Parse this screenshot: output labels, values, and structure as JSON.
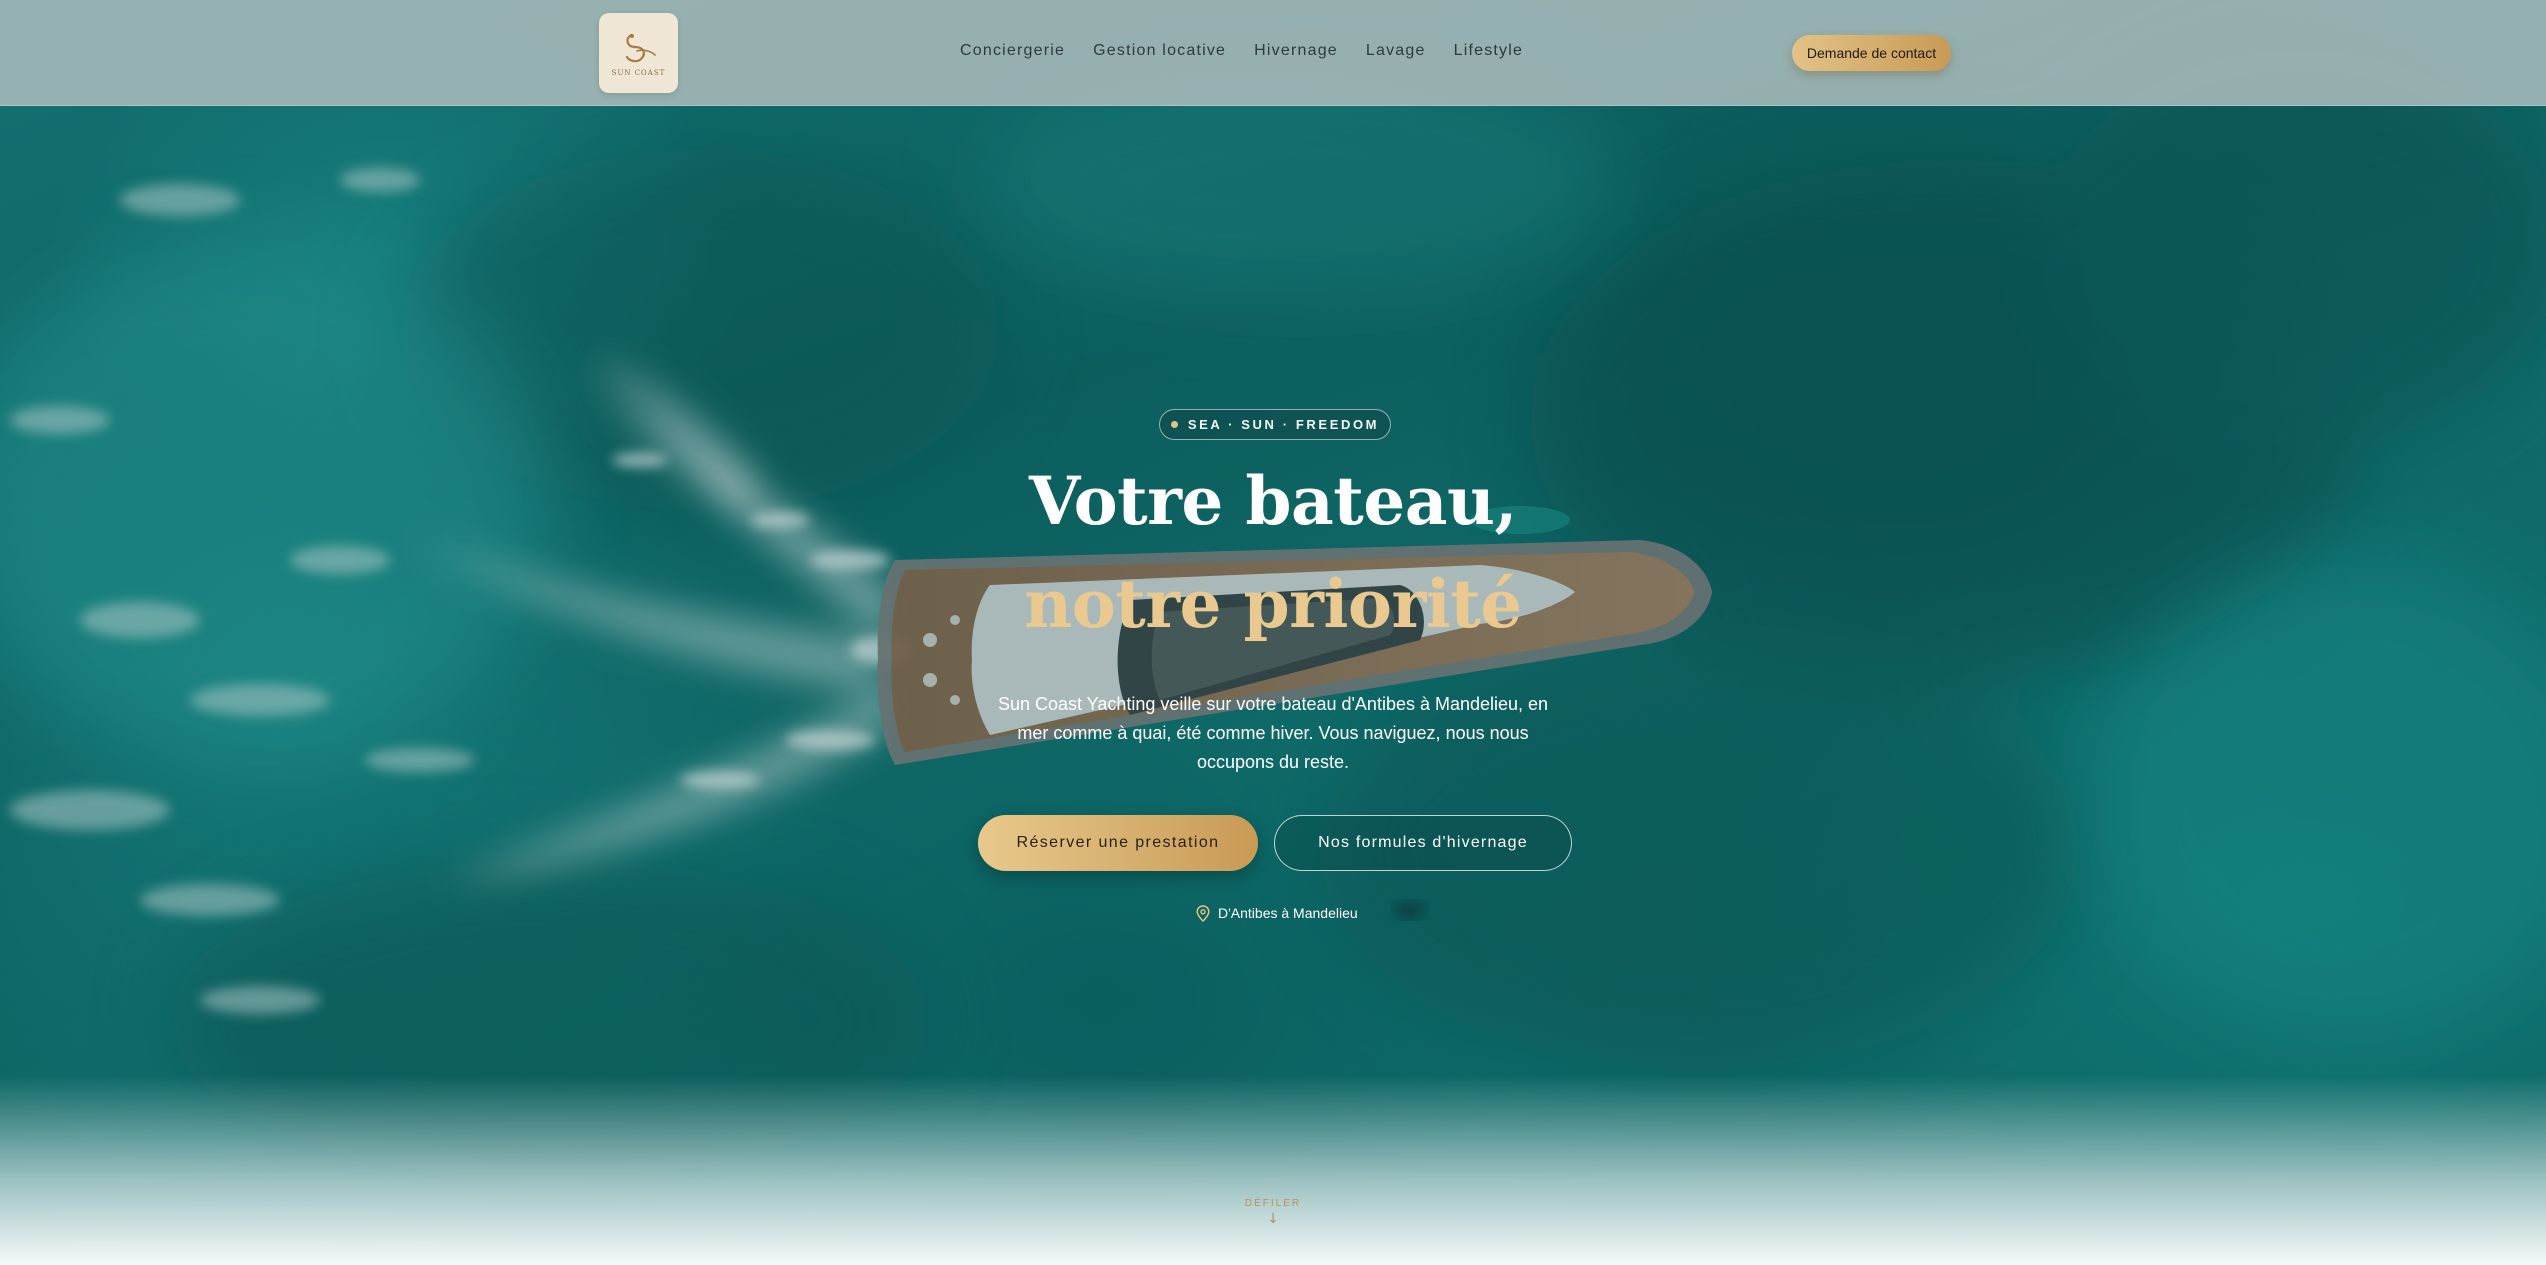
{
  "header": {
    "logo_text": "SUN COAST",
    "nav": [
      {
        "label": "Conciergerie"
      },
      {
        "label": "Gestion locative"
      },
      {
        "label": "Hivernage"
      },
      {
        "label": "Lavage"
      },
      {
        "label": "Lifestyle"
      }
    ],
    "contact_button": "Demande de contact"
  },
  "hero": {
    "tagline": "SEA · SUN · FREEDOM",
    "title_line1": "Votre bateau,",
    "title_line2": "notre priorité",
    "subtitle": "Sun Coast Yachting veille sur votre bateau d'Antibes à Mandelieu, en mer comme à quai, été comme hiver. Vous naviguez, nous nous occupons du reste.",
    "primary_button": "Réserver une prestation",
    "secondary_button": "Nos formules d'hivernage",
    "location": "D'Antibes à Mandelieu",
    "scroll_label": "DÉFILER",
    "scroll_icon": "arrow-down-icon"
  },
  "colors": {
    "accent_gold": "#e2c287",
    "sea_teal": "#0f6f6d",
    "header_bg": "#a0b6b6"
  }
}
